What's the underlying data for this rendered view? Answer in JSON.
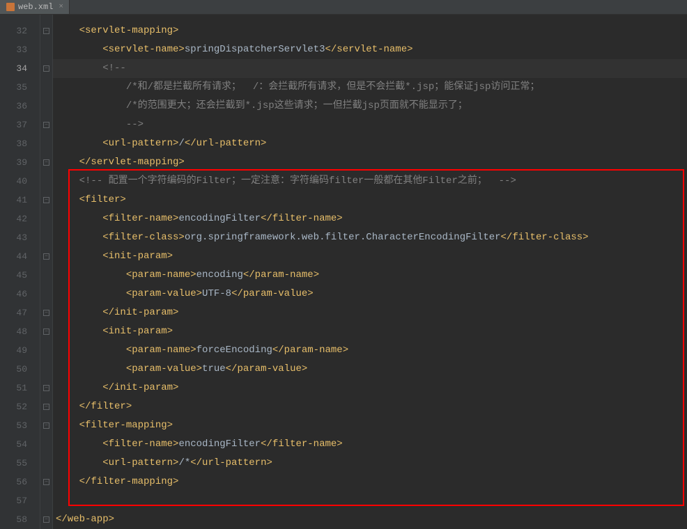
{
  "tab": {
    "filename": "web.xml",
    "close": "×"
  },
  "gutter": {
    "lines": [
      "32",
      "33",
      "34",
      "35",
      "36",
      "37",
      "38",
      "39",
      "40",
      "41",
      "42",
      "43",
      "44",
      "45",
      "46",
      "47",
      "48",
      "49",
      "50",
      "51",
      "52",
      "53",
      "54",
      "55",
      "56",
      "57",
      "58"
    ]
  },
  "code": {
    "l32": {
      "indent": "    ",
      "open": "<servlet-mapping>"
    },
    "l33": {
      "indent": "        ",
      "open": "<servlet-name>",
      "text": "springDispatcherServlet3",
      "close": "</servlet-name>"
    },
    "l34": {
      "indent": "        ",
      "comment": "<!--"
    },
    "l35": {
      "indent": "            ",
      "comment": "/*和/都是拦截所有请求；  /：会拦截所有请求，但是不会拦截*.jsp；能保证jsp访问正常；"
    },
    "l36": {
      "indent": "            ",
      "comment": "/*的范围更大；还会拦截到*.jsp这些请求；一但拦截jsp页面就不能显示了；"
    },
    "l37": {
      "indent": "            ",
      "comment": "-->"
    },
    "l38": {
      "indent": "        ",
      "open": "<url-pattern>",
      "text": "/",
      "close": "</url-pattern>"
    },
    "l39": {
      "indent": "    ",
      "close": "</servlet-mapping>"
    },
    "l40": {
      "indent": "    ",
      "comment": "<!-- 配置一个字符编码的Filter；一定注意：字符编码filter一般都在其他Filter之前；  -->"
    },
    "l41": {
      "indent": "    ",
      "open": "<filter>"
    },
    "l42": {
      "indent": "        ",
      "open": "<filter-name>",
      "text": "encodingFilter",
      "close": "</filter-name>"
    },
    "l43": {
      "indent": "        ",
      "open": "<filter-class>",
      "text": "org.springframework.web.filter.CharacterEncodingFilter",
      "close": "</filter-class>"
    },
    "l44": {
      "indent": "        ",
      "open": "<init-param>"
    },
    "l45": {
      "indent": "            ",
      "open": "<param-name>",
      "text": "encoding",
      "close": "</param-name>"
    },
    "l46": {
      "indent": "            ",
      "open": "<param-value>",
      "text": "UTF-8",
      "close": "</param-value>"
    },
    "l47": {
      "indent": "        ",
      "close": "</init-param>"
    },
    "l48": {
      "indent": "        ",
      "open": "<init-param>"
    },
    "l49": {
      "indent": "            ",
      "open": "<param-name>",
      "text": "forceEncoding",
      "close": "</param-name>"
    },
    "l50": {
      "indent": "            ",
      "open": "<param-value>",
      "text": "true",
      "close": "</param-value>"
    },
    "l51": {
      "indent": "        ",
      "close": "</init-param>"
    },
    "l52": {
      "indent": "    ",
      "close": "</filter>"
    },
    "l53": {
      "indent": "    ",
      "open": "<filter-mapping>"
    },
    "l54": {
      "indent": "        ",
      "open": "<filter-name>",
      "text": "encodingFilter",
      "close": "</filter-name>"
    },
    "l55": {
      "indent": "        ",
      "open": "<url-pattern>",
      "text": "/*",
      "close": "</url-pattern>"
    },
    "l56": {
      "indent": "    ",
      "close": "</filter-mapping>"
    },
    "l58": {
      "close": "</web-app>"
    }
  }
}
